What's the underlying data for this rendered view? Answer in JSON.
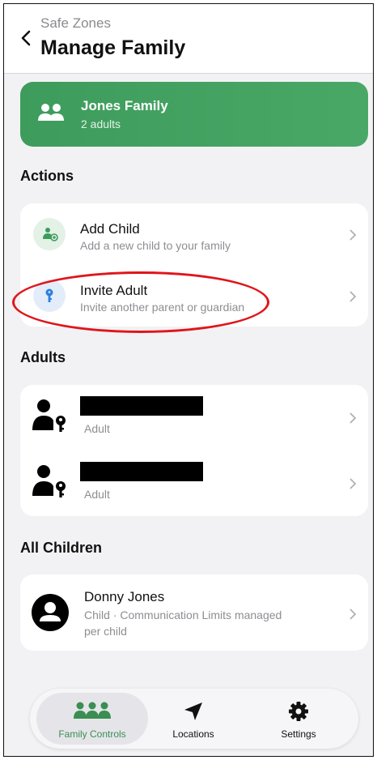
{
  "header": {
    "back_label": "Safe Zones",
    "title": "Manage Family"
  },
  "family": {
    "name": "Jones Family",
    "count": "2 adults",
    "accent": "#45a363"
  },
  "actions": {
    "title": "Actions",
    "items": [
      {
        "label": "Add Child",
        "sub": "Add a new child to your family",
        "icon": "add-child-icon"
      },
      {
        "label": "Invite Adult",
        "sub": "Invite another parent or guardian",
        "icon": "key-icon"
      }
    ]
  },
  "adults": {
    "title": "Adults",
    "items": [
      {
        "role": "Adult",
        "icon": "adult-key-icon"
      },
      {
        "role": "Adult",
        "icon": "adult-key-icon"
      }
    ]
  },
  "children": {
    "title": "All Children",
    "items": [
      {
        "name": "Donny Jones",
        "sub_line1": "Child · Communication Limits managed",
        "sub_line2": "per child",
        "icon": "person-circle-icon"
      }
    ]
  },
  "nav": {
    "items": [
      {
        "label": "Family Controls",
        "icon": "family-icon",
        "active": true
      },
      {
        "label": "Locations",
        "icon": "location-arrow-icon",
        "active": false
      },
      {
        "label": "Settings",
        "icon": "gear-icon",
        "active": false
      }
    ]
  }
}
